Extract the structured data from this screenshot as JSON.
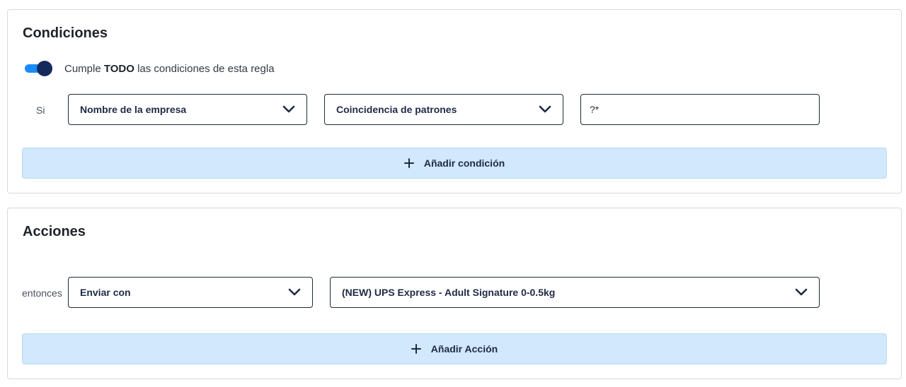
{
  "conditions": {
    "title": "Condiciones",
    "toggle": {
      "enabled": true,
      "text_before": "Cumple ",
      "text_bold": "TODO",
      "text_after": " las condiciones de esta regla"
    },
    "row": {
      "label": "Si",
      "field_select": "Nombre de la empresa",
      "operator_select": "Coincidencia de patrones",
      "value_input": "?*"
    },
    "add_button": "Añadir condición"
  },
  "actions": {
    "title": "Acciones",
    "row": {
      "label": "entonces",
      "action_select": "Enviar con",
      "value_select": "(NEW) UPS Express - Adult Signature 0-0.5kg"
    },
    "add_button": "Añadir Acción"
  },
  "colors": {
    "toggle_track": "#1a8cff",
    "toggle_knob": "#142a5c",
    "add_button_bg": "#d1e8fd"
  },
  "icons": {
    "select_chevron": "chevron-down-icon",
    "add": "plus-icon"
  }
}
